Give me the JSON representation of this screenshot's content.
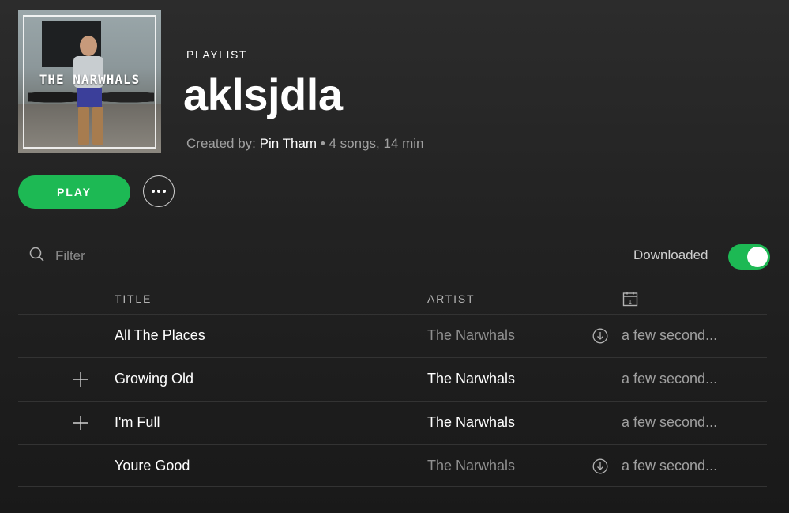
{
  "playlist": {
    "type_label": "PLAYLIST",
    "title": "aklsjdla",
    "created_by_label": "Created by:",
    "owner": "Pin Tham",
    "summary": "• 4 songs, 14 min",
    "cover_text": "THE NARWHALS"
  },
  "actions": {
    "play_label": "PLAY",
    "more_icon": "ellipsis-icon"
  },
  "filter": {
    "placeholder": "Filter",
    "icon": "search-icon"
  },
  "downloaded": {
    "label": "Downloaded",
    "enabled": true,
    "color": "#1db954"
  },
  "columns": {
    "title": "TITLE",
    "artist": "ARTIST",
    "date_icon": "calendar-icon"
  },
  "tracks": [
    {
      "title": "All The Places",
      "artist": "The Narwhals",
      "added": "a few second...",
      "downloaded": true,
      "addable": false
    },
    {
      "title": "Growing Old",
      "artist": "The Narwhals",
      "added": "a few second...",
      "downloaded": false,
      "addable": true
    },
    {
      "title": "I'm Full",
      "artist": "The Narwhals",
      "added": "a few second...",
      "downloaded": false,
      "addable": true
    },
    {
      "title": "Youre Good",
      "artist": "The Narwhals",
      "added": "a few second...",
      "downloaded": true,
      "addable": false
    }
  ],
  "colors": {
    "accent": "#1db954",
    "background": "#222222"
  }
}
